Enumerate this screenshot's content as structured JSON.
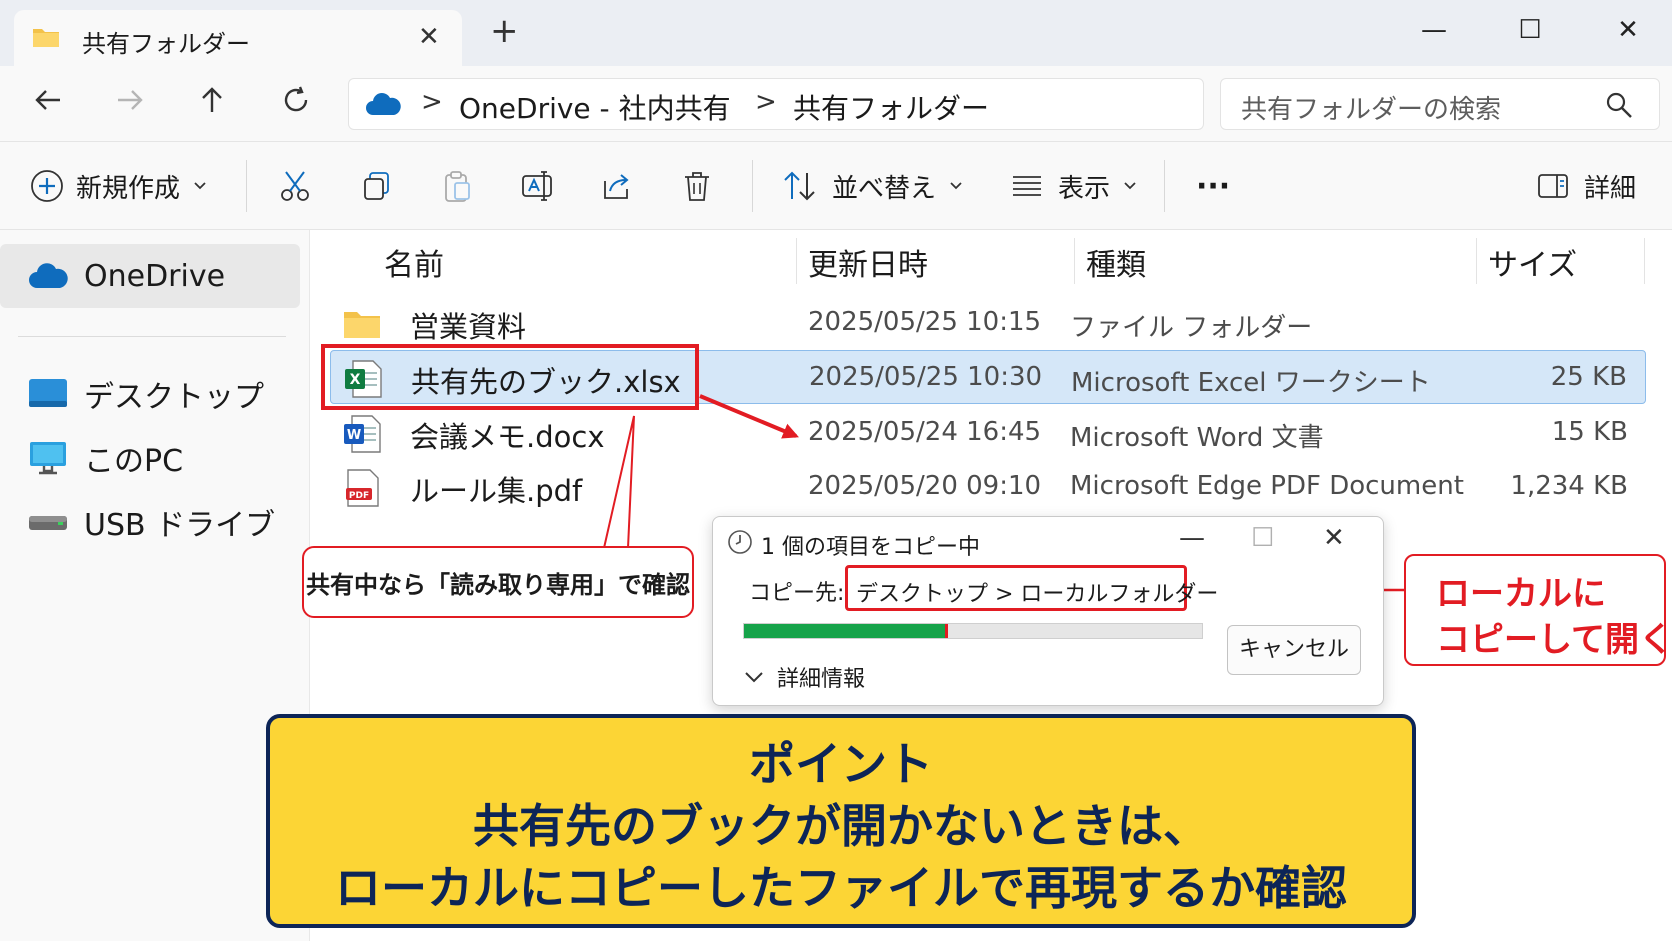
{
  "window": {
    "tab_title": "共有フォルダー",
    "tab_close": "✕",
    "new_tab": "+",
    "minimize": "—",
    "maximize": "☐",
    "close": "✕"
  },
  "address_bar": {
    "crumbs": [
      "OneDrive - 社内共有",
      "共有フォルダー"
    ],
    "separator": ">",
    "search_placeholder": "共有フォルダーの検索"
  },
  "toolbar": {
    "new_label": "新規作成",
    "sort_label": "並べ替え",
    "view_label": "表示",
    "more_label": "···",
    "details_label": "詳細"
  },
  "sidebar": {
    "items": [
      {
        "label": "OneDrive",
        "icon": "cloud-icon"
      },
      {
        "label": "デスクトップ",
        "icon": "desktop-icon"
      },
      {
        "label": "このPC",
        "icon": "computer-icon"
      },
      {
        "label": "USB ドライブ",
        "icon": "usb-drive-icon"
      }
    ]
  },
  "file_list": {
    "columns": [
      "名前",
      "更新日時",
      "種類",
      "サイズ"
    ],
    "rows": [
      {
        "name": "営業資料",
        "modified": "2025/05/25 10:15",
        "type": "ファイル フォルダー",
        "size": "",
        "icon": "folder-icon"
      },
      {
        "name": "共有先のブック.xlsx",
        "modified": "2025/05/25 10:30",
        "type": "Microsoft Excel ワークシート",
        "size": "25 KB",
        "icon": "excel-icon",
        "selected": true
      },
      {
        "name": "会議メモ.docx",
        "modified": "2025/05/24 16:45",
        "type": "Microsoft Word 文書",
        "size": "15 KB",
        "icon": "word-icon"
      },
      {
        "name": "ルール集.pdf",
        "modified": "2025/05/20 09:10",
        "type": "Microsoft Edge PDF Document",
        "size": "1,234 KB",
        "icon": "pdf-icon"
      }
    ]
  },
  "copy_dialog": {
    "title": "1 個の項目をコピー中",
    "dest_label": "コピー先:",
    "dest_path": "デスクトップ > ローカルフォルダー",
    "progress": 0.44,
    "details_label": "詳細情報",
    "cancel_label": "キャンセル"
  },
  "annotations": {
    "readonly_note": "共有中なら「読み取り専用」で確認",
    "local_note_line1": "ローカルに",
    "local_note_line2": "コピーして開く"
  },
  "point_box": {
    "title": "ポイント",
    "line1": "共有先のブックが開かないときは、",
    "line2": "ローカルにコピーしたファイルで再現するか確認"
  },
  "colors": {
    "accent_red": "#e21c23",
    "banner_yellow": "#fcd535",
    "banner_navy": "#0d2557",
    "selection_blue": "#d5e7f8",
    "progress_green": "#16a34a"
  }
}
